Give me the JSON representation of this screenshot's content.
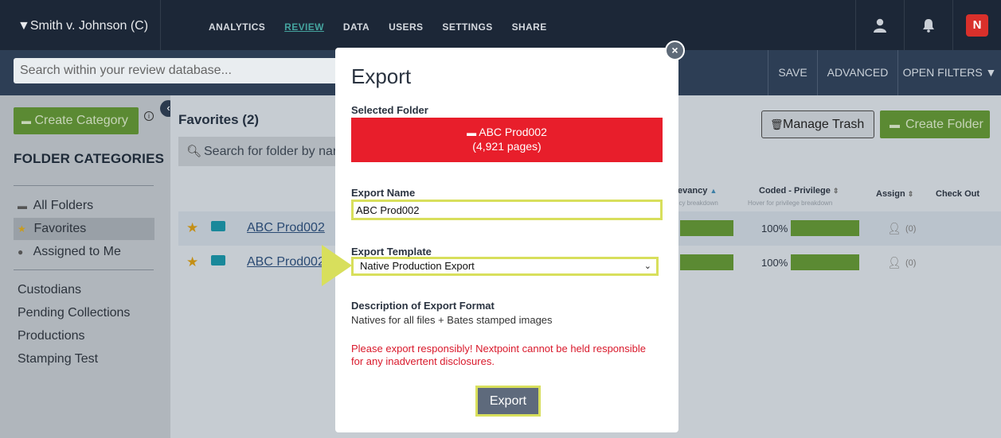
{
  "topbar": {
    "case_name": "▼Smith v. Johnson (C)",
    "nav": [
      "ANALYTICS",
      "REVIEW",
      "DATA",
      "USERS",
      "SETTINGS",
      "SHARE"
    ],
    "active_nav": "REVIEW",
    "logo_text": "N",
    "icons": [
      "user-icon",
      "bell-icon",
      "nextpoint-logo"
    ]
  },
  "searchbar": {
    "placeholder": "Search within your review database...",
    "save": "SAVE",
    "advanced": "ADVANCED",
    "open_filters": "OPEN FILTERS ▼"
  },
  "sidebar": {
    "create_category": "Create Category",
    "folder_categories": "FOLDER CATEGORIES",
    "items": [
      {
        "label": "All Folders",
        "icon": "folder-icon"
      },
      {
        "label": "Favorites",
        "icon": "star-icon",
        "selected": true
      },
      {
        "label": "Assigned to Me",
        "icon": "user-icon"
      }
    ],
    "categories": [
      "Custodians",
      "Pending Collections",
      "Productions",
      "Stamping Test"
    ]
  },
  "main": {
    "title": "Favorites (2)",
    "search_placeholder": "Search for folder by nar",
    "manage_trash": "Manage Trash",
    "create_folder": "Create Folder",
    "columns": {
      "relevancy": "levancy",
      "relevancy_sub": "ncy breakdown",
      "privilege": "Coded - Privilege",
      "privilege_sub": "Hover for privilege breakdown",
      "assign": "Assign",
      "checkout": "Check Out"
    },
    "rows": [
      {
        "name": "ABC Prod002",
        "privilege_pct": "100%",
        "assign_count": "(0)"
      },
      {
        "name": "ABC Prod002",
        "privilege_pct": "100%",
        "assign_count": "(0)"
      }
    ]
  },
  "modal": {
    "title": "Export",
    "selected_folder_label": "Selected Folder",
    "selected_folder_name": "ABC Prod002",
    "selected_folder_pages": "(4,921 pages)",
    "export_name_label": "Export Name",
    "export_name_value": "ABC Prod002",
    "export_template_label": "Export Template",
    "export_template_value": "Native Production Export",
    "description_label": "Description of Export Format",
    "description_text": "Natives for all files + Bates stamped images",
    "warning": "Please export responsibly! Nextpoint cannot be held responsible for any inadvertent disclosures.",
    "export_button": "Export",
    "close": "×"
  },
  "colors": {
    "topbar_bg": "#1c2737",
    "accent_green": "#5b8a33",
    "folder_red": "#e81e2b",
    "highlight_yellow": "#d8df5c",
    "warning_red": "#d9192b"
  }
}
